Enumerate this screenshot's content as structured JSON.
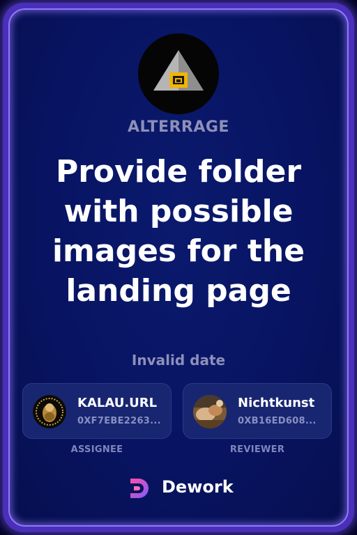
{
  "organization": {
    "name": "ALTERRAGE",
    "logo_icon": "alterrage-pyramid-icon"
  },
  "task": {
    "title": "Provide folder with possible images for the landing page",
    "date": "Invalid date"
  },
  "assignee": {
    "name": "KALAU.URL",
    "address": "0XF7EBE2263...",
    "role": "ASSIGNEE"
  },
  "reviewer": {
    "name": "Nichtkunst",
    "address": "0XB16ED608...",
    "role": "REVIEWER"
  },
  "brand": {
    "name": "Dework",
    "icon": "dework-logo-icon"
  },
  "colors": {
    "card_background": "#081462",
    "border_glow": "#8f78ff",
    "muted_text": "#8e90b9",
    "person_card": "#182671"
  }
}
